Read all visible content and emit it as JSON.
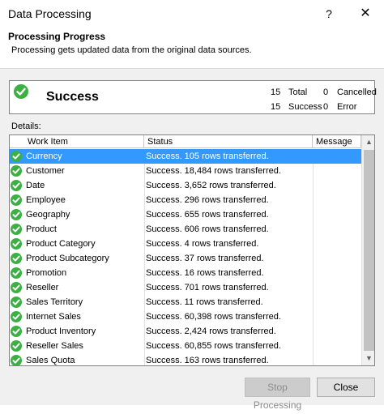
{
  "window": {
    "title": "Data Processing",
    "help_label": "?",
    "close_label": "✕"
  },
  "header": {
    "title": "Processing Progress",
    "description": "Processing gets updated data from the original data sources."
  },
  "summary": {
    "status": "Success",
    "counts": [
      {
        "value": "15",
        "label": "Total"
      },
      {
        "value": "0",
        "label": "Cancelled"
      },
      {
        "value": "15",
        "label": "Success"
      },
      {
        "value": "0",
        "label": "Error"
      }
    ]
  },
  "details": {
    "label": "Details:",
    "columns": [
      "Work Item",
      "Status",
      "Message"
    ],
    "rows": [
      {
        "item": "Currency",
        "status": "Success. 105 rows transferred.",
        "message": ""
      },
      {
        "item": "Customer",
        "status": "Success. 18,484 rows transferred.",
        "message": ""
      },
      {
        "item": "Date",
        "status": "Success. 3,652 rows transferred.",
        "message": ""
      },
      {
        "item": "Employee",
        "status": "Success. 296 rows transferred.",
        "message": ""
      },
      {
        "item": "Geography",
        "status": "Success. 655 rows transferred.",
        "message": ""
      },
      {
        "item": "Product",
        "status": "Success. 606 rows transferred.",
        "message": ""
      },
      {
        "item": "Product Category",
        "status": "Success. 4 rows transferred.",
        "message": ""
      },
      {
        "item": "Product Subcategory",
        "status": "Success. 37 rows transferred.",
        "message": ""
      },
      {
        "item": "Promotion",
        "status": "Success. 16 rows transferred.",
        "message": ""
      },
      {
        "item": "Reseller",
        "status": "Success. 701 rows transferred.",
        "message": ""
      },
      {
        "item": "Sales Territory",
        "status": "Success. 11 rows transferred.",
        "message": ""
      },
      {
        "item": "Internet Sales",
        "status": "Success. 60,398 rows transferred.",
        "message": ""
      },
      {
        "item": "Product Inventory",
        "status": "Success. 2,424 rows transferred.",
        "message": ""
      },
      {
        "item": "Reseller Sales",
        "status": "Success. 60,855 rows transferred.",
        "message": ""
      },
      {
        "item": "Sales Quota",
        "status": "Success. 163 rows transferred.",
        "message": ""
      }
    ]
  },
  "buttons": {
    "stop_label": "Stop Processing",
    "close_label": "Close"
  },
  "colors": {
    "success": "#3cb043",
    "selection": "#3399ff"
  },
  "icons": {
    "status_icon": "success-check-icon"
  }
}
